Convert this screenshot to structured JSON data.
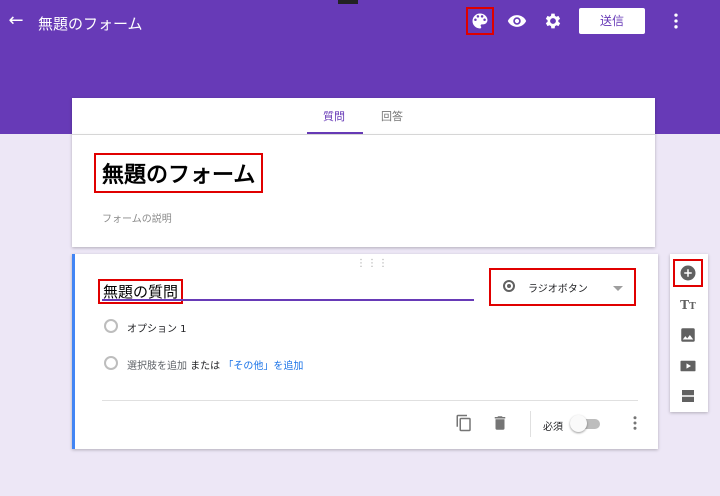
{
  "header": {
    "title": "無題のフォーム",
    "send_label": "送信",
    "icons": [
      "back-arrow-icon",
      "palette-icon",
      "eye-icon",
      "gear-icon",
      "more-vert-icon"
    ]
  },
  "tabs": [
    {
      "label": "質問",
      "active": true
    },
    {
      "label": "回答",
      "active": false
    }
  ],
  "form": {
    "title": "無題のフォーム",
    "description_placeholder": "フォームの説明"
  },
  "question": {
    "title": "無題の質問",
    "type_label": "ラジオボタン",
    "option1": "オプション 1",
    "add_option": "選択肢を追加",
    "or_text": " または ",
    "add_other": "「その他」を追加",
    "required_label": "必須",
    "required_on": false
  },
  "colors": {
    "accent": "#673ab7",
    "background": "#ede7f6",
    "highlight_outline": "#e00000",
    "link": "#1a73e8",
    "question_left_border": "#4285f4"
  }
}
